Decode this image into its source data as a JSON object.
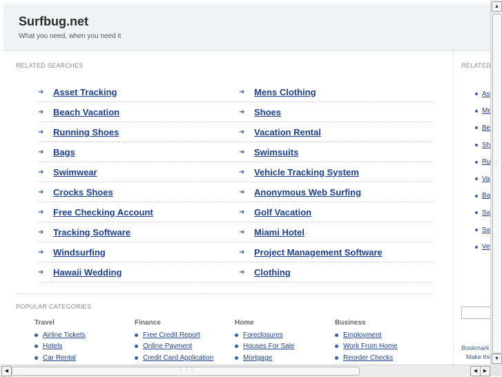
{
  "header": {
    "title": "Surfbug.net",
    "tagline": "What you need, when you need it"
  },
  "related": {
    "label": "RELATED SEARCHES",
    "links": [
      "Asset Tracking",
      "Mens Clothing",
      "Beach Vacation",
      "Shoes",
      "Running Shoes",
      "Vacation Rental",
      "Bags",
      "Swimsuits",
      "Swimwear",
      "Vehicle Tracking System",
      "Crocks Shoes",
      "Anonymous Web Surfing",
      "Free Checking Account",
      "Golf Vacation",
      "Tracking Software",
      "Miami Hotel",
      "Windsurfing",
      "Project Management Software",
      "Hawaii Wedding",
      "Clothing"
    ]
  },
  "popular": {
    "label": "POPULAR CATEGORIES",
    "categories": [
      {
        "title": "Travel",
        "items": [
          "Airline Tickets",
          "Hotels",
          "Car Rental"
        ]
      },
      {
        "title": "Finance",
        "items": [
          "Free Credit Report",
          "Online Payment",
          "Credit Card Application"
        ]
      },
      {
        "title": "Home",
        "items": [
          "Foreclosures",
          "Houses For Sale",
          "Mortgage"
        ]
      },
      {
        "title": "Business",
        "items": [
          "Employment",
          "Work From Home",
          "Reorder Checks"
        ]
      }
    ]
  },
  "sidebar": {
    "label": "RELATED",
    "items": [
      "Ass",
      "Me",
      "Bea",
      "Sho",
      "Ru",
      "Va",
      "Ba",
      "Sw",
      "Sw",
      "Ve"
    ],
    "footer1": "Bookmark",
    "footer2": "Make this"
  },
  "icons": {
    "link_arrow": "arrow-right-icon",
    "scroll_up": "scroll-up-icon",
    "scroll_down": "scroll-down-icon",
    "scroll_left": "scroll-left-icon",
    "scroll_right": "scroll-right-icon"
  },
  "colors": {
    "link": "#1b3f92",
    "header_bg": "#eef3f6",
    "bullet": "#2f5ea8"
  }
}
